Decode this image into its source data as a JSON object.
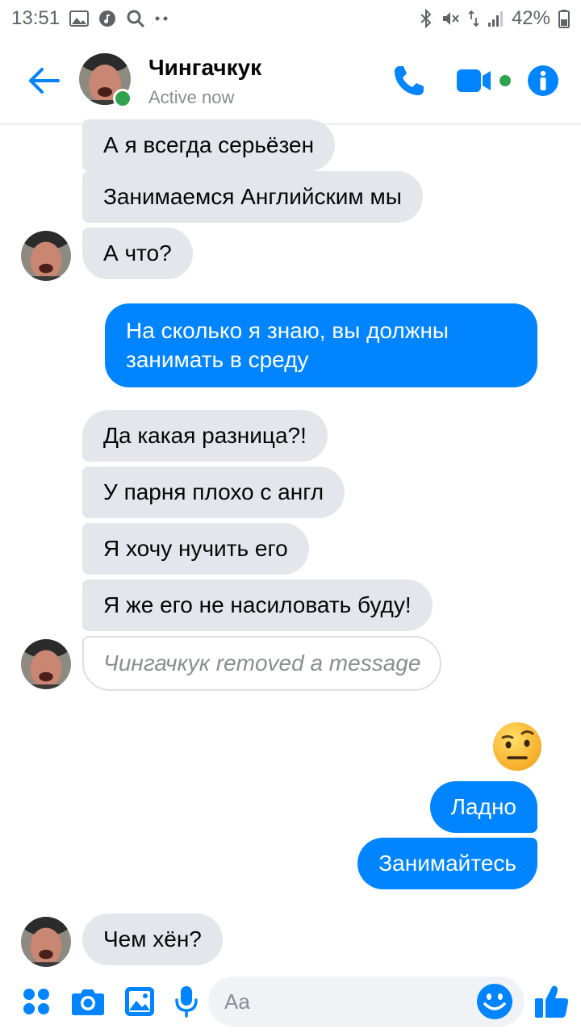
{
  "status_bar": {
    "time": "13:51",
    "battery": "42%"
  },
  "header": {
    "contact_name": "Чингачкук",
    "contact_status": "Active now"
  },
  "messages": [
    {
      "text": "А я всегда серьёзен"
    },
    {
      "text": "Занимаемся Английским мы"
    },
    {
      "text": "А что?"
    },
    {
      "text": "На сколько я знаю, вы должны"
    },
    {
      "text": "занимать в среду"
    },
    {
      "text": "Да какая разница?!"
    },
    {
      "text": "У парня плохо с англ"
    },
    {
      "text": "Я хочу нучить его"
    },
    {
      "text": "Я же его не насиловать буду!"
    },
    {
      "text": "Чингачкук removed a message"
    },
    {
      "text": "Ладно"
    },
    {
      "text": "Занимайтесь"
    },
    {
      "text": "Чем хён?"
    }
  ],
  "composer": {
    "placeholder": "Aa"
  },
  "colors": {
    "accent": "#0084ff",
    "incoming_bubble": "#e4e6eb",
    "presence": "#31a24c"
  },
  "icons": [
    "gallery-icon",
    "music-icon",
    "search-icon",
    "bluetooth-icon",
    "mute-icon",
    "signal-icon",
    "battery-icon",
    "back-arrow-icon",
    "phone-icon",
    "video-icon",
    "info-icon",
    "menu-dots-icon",
    "camera-icon",
    "image-icon",
    "mic-icon",
    "emoji-icon",
    "thumbs-up-icon"
  ]
}
